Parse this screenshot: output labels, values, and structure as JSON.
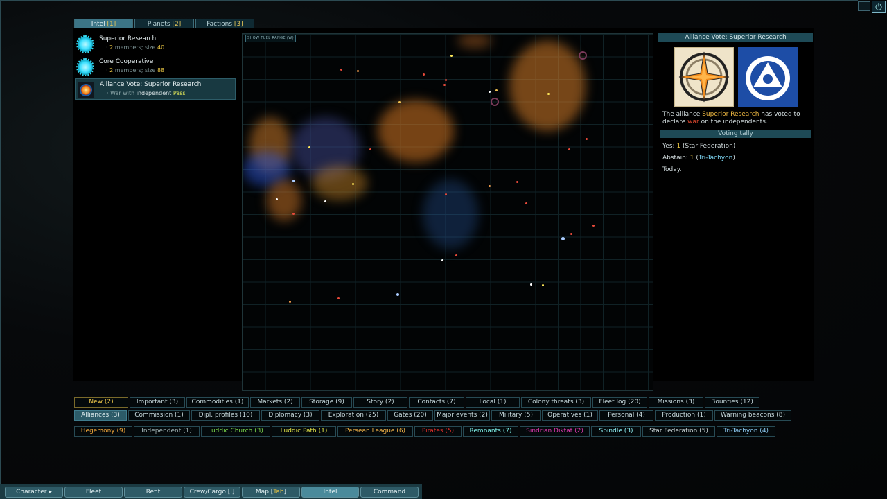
{
  "tabs": [
    {
      "label": "Intel",
      "count": "1"
    },
    {
      "label": "Planets",
      "count": "2"
    },
    {
      "label": "Factions",
      "count": "3"
    }
  ],
  "intel_items": [
    {
      "title": "Superior Research",
      "bullet": "·",
      "count": "2",
      "members_text": "members; size",
      "size": "40"
    },
    {
      "title": "Core Cooperative",
      "bullet": "·",
      "count": "2",
      "members_text": "members; size",
      "size": "88"
    },
    {
      "title": "Alliance Vote: Superior Research",
      "bullet": "·",
      "war_text": "War with",
      "faction": "independent",
      "result": "Pass"
    }
  ],
  "map": {
    "fuel_button": "SHOW FUEL RANGE (W)"
  },
  "detail": {
    "header": "Alliance Vote: Superior Research",
    "line1": "The alliance",
    "alliance": "Superior Research",
    "line2": "has voted to declare",
    "war": "war",
    "line3": "on the",
    "target": "independents.",
    "tally_header": "Voting tally",
    "yes_label": "Yes:",
    "yes_count": "1",
    "yes_faction": "(Star Federation)",
    "abstain_label": "Abstain:",
    "abstain_count": "1",
    "abstain_faction": "Tri-Tachyon",
    "today": "Today."
  },
  "filters_row1": [
    "New (2)",
    "Important (3)",
    "Commodities (1)",
    "Markets (2)",
    "Storage (9)",
    "Story (2)",
    "Contacts (7)",
    "Local (1)",
    "Colony threats (3)",
    "Fleet log (20)",
    "Missions (3)",
    "Bounties (12)"
  ],
  "filters_row2": [
    "Alliances (3)",
    "Commission (1)",
    "Dipl. profiles (10)",
    "Diplomacy (3)",
    "Exploration (25)",
    "Gates (20)",
    "Major events (2)",
    "Military (5)",
    "Operatives (1)",
    "Personal (4)",
    "Production (1)",
    "Warning beacons (8)"
  ],
  "filters_row3": [
    "Hegemony (9)",
    "Independent (1)",
    "Luddic Church (3)",
    "Luddic Path (1)",
    "Persean League (6)",
    "Pirates (5)",
    "Remnants (7)",
    "Sindrian Diktat (2)",
    "Spindle (3)",
    "Star Federation (5)",
    "Tri-Tachyon (4)"
  ],
  "faction_colors": [
    "#f0a63a",
    "#9fb0b2",
    "#78d24a",
    "#e6e84a",
    "#f0b248",
    "#e0302a",
    "#7ef0e8",
    "#e03ab0",
    "#8ff0f4",
    "#c8d2d4",
    "#8cc8f0"
  ],
  "nav": [
    {
      "label": "Character",
      "key": "C"
    },
    {
      "label": "Fleet",
      "key": "F"
    },
    {
      "label": "Refit",
      "key": "R"
    },
    {
      "label": "Crew/Cargo",
      "key": "I"
    },
    {
      "label": "Map",
      "key": "Tab"
    },
    {
      "label": "Intel",
      "key": "E"
    },
    {
      "label": "Command",
      "key": "D"
    }
  ],
  "icons": {
    "corner": "power-icon",
    "intel1": "faction-star-icon",
    "intel3": "alliance-vote-icon"
  }
}
